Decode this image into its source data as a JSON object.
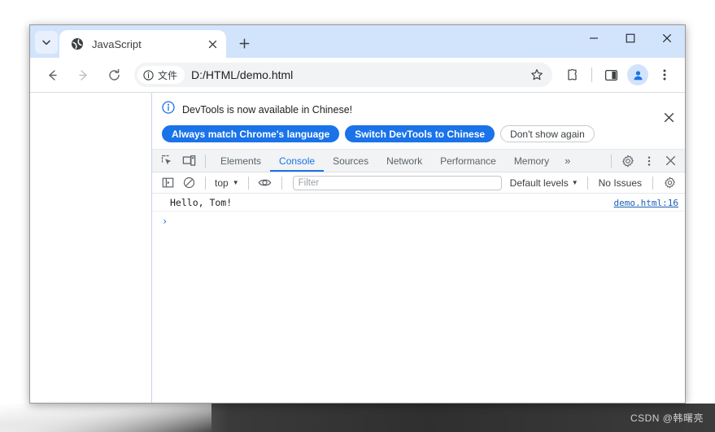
{
  "window": {
    "controls": {
      "minimize": "minimize-icon",
      "maximize": "maximize-icon",
      "close": "close-icon"
    }
  },
  "tabstrip": {
    "tab_search_icon": "chevron-down-icon",
    "tabs": [
      {
        "title": "JavaScript",
        "favicon": "globe-favicon",
        "close_label": "×"
      }
    ],
    "new_tab_label": "+"
  },
  "toolbar": {
    "back_icon": "arrow-left-icon",
    "forward_icon": "arrow-right-icon",
    "reload_icon": "reload-icon",
    "security_chip_label": "文件",
    "url": "D:/HTML/demo.html",
    "star_icon": "star-icon",
    "extensions_icon": "puzzle-icon",
    "sidepanel_icon": "side-panel-icon",
    "profile_icon": "person-icon",
    "menu_icon": "three-dot-menu-icon"
  },
  "devtools": {
    "banner": {
      "info_icon": "info-icon",
      "message": "DevTools is now available in Chinese!",
      "buttons": [
        {
          "label": "Always match Chrome's language",
          "style": "primary"
        },
        {
          "label": "Switch DevTools to Chinese",
          "style": "primary"
        },
        {
          "label": "Don't show again",
          "style": "ghost"
        }
      ],
      "close_label": "✕"
    },
    "tabbar": {
      "inspect_icon": "inspect-element-icon",
      "device_icon": "device-toolbar-icon",
      "tabs": [
        {
          "label": "Elements",
          "active": false
        },
        {
          "label": "Console",
          "active": true
        },
        {
          "label": "Sources",
          "active": false
        },
        {
          "label": "Network",
          "active": false
        },
        {
          "label": "Performance",
          "active": false
        },
        {
          "label": "Memory",
          "active": false
        }
      ],
      "overflow_label": "»",
      "settings_icon": "gear-icon",
      "more_icon": "three-dot-menu-icon",
      "close_icon": "close-icon"
    },
    "filterbar": {
      "sidebar_icon": "console-sidebar-icon",
      "clear_icon": "clear-console-icon",
      "context": "top",
      "context_caret": "▼",
      "eye_icon": "live-expression-icon",
      "filter_placeholder": "Filter",
      "filter_value": "",
      "levels_label": "Default levels",
      "levels_caret": "▼",
      "issues_label": "No Issues",
      "settings_icon": "gear-icon"
    },
    "console": {
      "messages": [
        {
          "text": "Hello, Tom!",
          "source": "demo.html:16"
        }
      ],
      "prompt_chevron": "›",
      "prompt_value": ""
    }
  },
  "watermark": "CSDN @韩曙亮",
  "colors": {
    "accent": "#1a73e8",
    "titlebar": "#d2e3fc",
    "devtools_tabbar": "#f1f3f4",
    "link": "#1a5fb4"
  }
}
